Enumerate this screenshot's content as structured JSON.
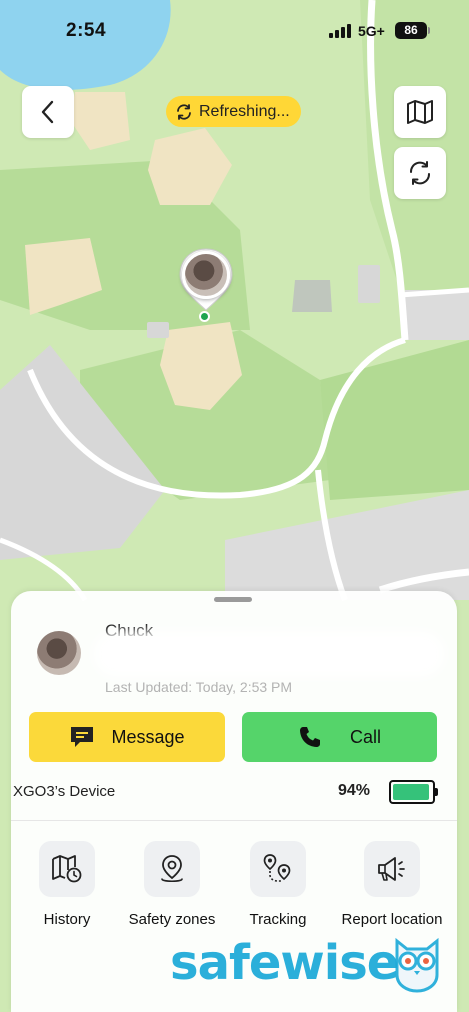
{
  "status_bar": {
    "time": "2:54",
    "network": "5G+",
    "battery": "86"
  },
  "map": {
    "refresh_status": "Refreshing..."
  },
  "contact": {
    "name": "Chuck",
    "last_updated": "Last Updated: Today, 2:53 PM"
  },
  "buttons": {
    "message_label": "Message",
    "call_label": "Call"
  },
  "device": {
    "name": "XGO3’s Device",
    "battery_percent": "94%",
    "battery_level": 0.94
  },
  "actions": [
    {
      "label": "History",
      "icon": "map-history-icon"
    },
    {
      "label": "Safety zones",
      "icon": "location-pin-icon"
    },
    {
      "label": "Tracking",
      "icon": "route-icon"
    },
    {
      "label": "Report location",
      "icon": "megaphone-icon"
    }
  ],
  "watermark": {
    "text": "safewise"
  },
  "colors": {
    "accent_yellow": "#fbd93a",
    "call_green": "#55d46a",
    "battery_green": "#35c27a",
    "map_park": "#cfe9b4",
    "map_water": "#8fd3ef"
  }
}
